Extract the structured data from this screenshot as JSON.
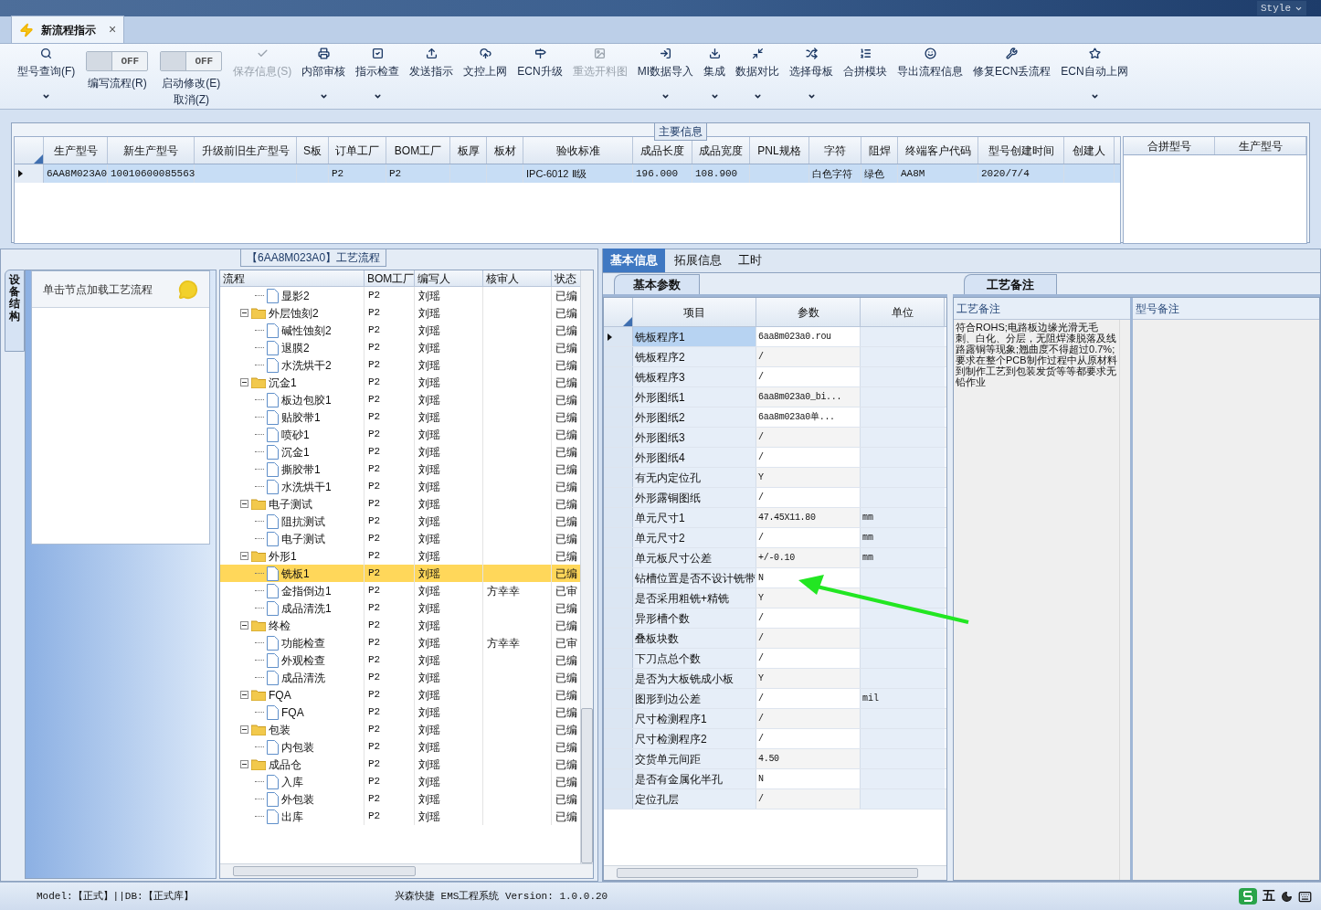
{
  "window": {
    "style_menu": "Style"
  },
  "doc_tab": {
    "title": "新流程指示",
    "close": "×"
  },
  "toolbar": [
    {
      "kind": "button",
      "label": "型号查询(F)",
      "dropdown": true,
      "disabled": false
    },
    {
      "kind": "toggle",
      "label": "编写流程(R)",
      "switch_text": "OFF",
      "on": false
    },
    {
      "kind": "toggle",
      "label": "启动修改(E)",
      "sub_label": "取消(Z)",
      "switch_text": "OFF",
      "on": false
    },
    {
      "kind": "button",
      "label": "保存信息(S)",
      "dropdown": false,
      "disabled": true
    },
    {
      "kind": "button",
      "label": "内部审核",
      "dropdown": true,
      "disabled": false
    },
    {
      "kind": "button",
      "label": "指示检查",
      "dropdown": true,
      "disabled": false
    },
    {
      "kind": "button",
      "label": "发送指示",
      "dropdown": false,
      "disabled": false
    },
    {
      "kind": "button",
      "label": "文控上网",
      "dropdown": false,
      "disabled": false
    },
    {
      "kind": "button",
      "label": "ECN升级",
      "dropdown": false,
      "disabled": false
    },
    {
      "kind": "button",
      "label": "重选开料图",
      "dropdown": false,
      "disabled": true
    },
    {
      "kind": "button",
      "label": "MI数据导入",
      "dropdown": true,
      "disabled": false
    },
    {
      "kind": "button",
      "label": "集成",
      "dropdown": true,
      "disabled": false
    },
    {
      "kind": "button",
      "label": "数据对比",
      "dropdown": true,
      "disabled": false
    },
    {
      "kind": "button",
      "label": "选择母板",
      "dropdown": true,
      "disabled": false
    },
    {
      "kind": "button",
      "label": "合拼模块",
      "dropdown": false,
      "disabled": false
    },
    {
      "kind": "button",
      "label": "导出流程信息",
      "dropdown": false,
      "disabled": false
    },
    {
      "kind": "button",
      "label": "修复ECN丢流程",
      "dropdown": false,
      "disabled": false
    },
    {
      "kind": "button",
      "label": "ECN自动上网",
      "dropdown": true,
      "disabled": false
    }
  ],
  "main_info": {
    "title": "主要信息",
    "columns": [
      "生产型号",
      "新生产型号",
      "升级前旧生产型号",
      "S板",
      "订单工厂",
      "BOM工厂",
      "板厚",
      "板材",
      "验收标准",
      "成品长度",
      "成品宽度",
      "PNL规格",
      "字符",
      "阻焊",
      "终端客户代码",
      "型号创建时间",
      "创建人"
    ],
    "rows": [
      {
        "selected": true,
        "cells": [
          "6AA8M023A0",
          "10010600085563",
          null,
          null,
          "P2",
          "P2",
          null,
          null,
          "IPC-6012 Ⅱ级",
          "196.000",
          "108.900",
          null,
          "白色字符",
          "绿色",
          "AA8M",
          "2020/7/4",
          null
        ]
      }
    ],
    "side_columns": [
      "合拼型号",
      "生产型号"
    ]
  },
  "process_panel": {
    "title": "【6AA8M023A0】工艺流程",
    "side_tab": "设备结构",
    "hint": "单击节点加载工艺流程",
    "columns": [
      "流程",
      "BOM工厂",
      "编写人",
      "核审人",
      "状态"
    ],
    "tree": [
      {
        "kind": "leaf",
        "label": "显影2",
        "bom": "P2",
        "writer": "刘瑶",
        "status": "已编",
        "selected": false
      },
      {
        "kind": "folder",
        "label": "外层蚀刻2",
        "bom": "P2",
        "writer": "刘瑶",
        "status": "已编",
        "selected": false,
        "expanded": true,
        "children": [
          {
            "kind": "leaf",
            "label": "碱性蚀刻2",
            "bom": "P2",
            "writer": "刘瑶",
            "status": "已编",
            "selected": false
          },
          {
            "kind": "leaf",
            "label": "退膜2",
            "bom": "P2",
            "writer": "刘瑶",
            "status": "已编",
            "selected": false
          },
          {
            "kind": "leaf",
            "label": "水洗烘干2",
            "bom": "P2",
            "writer": "刘瑶",
            "status": "已编",
            "selected": false
          }
        ]
      },
      {
        "kind": "folder",
        "label": "沉金1",
        "bom": "P2",
        "writer": "刘瑶",
        "status": "已编",
        "selected": false,
        "expanded": true,
        "children": [
          {
            "kind": "leaf",
            "label": "板边包胶1",
            "bom": "P2",
            "writer": "刘瑶",
            "status": "已编",
            "selected": false
          },
          {
            "kind": "leaf",
            "label": "贴胶带1",
            "bom": "P2",
            "writer": "刘瑶",
            "status": "已编",
            "selected": false
          },
          {
            "kind": "leaf",
            "label": "喷砂1",
            "bom": "P2",
            "writer": "刘瑶",
            "status": "已编",
            "selected": false
          },
          {
            "kind": "leaf",
            "label": "沉金1",
            "bom": "P2",
            "writer": "刘瑶",
            "status": "已编",
            "selected": false
          },
          {
            "kind": "leaf",
            "label": "撕胶带1",
            "bom": "P2",
            "writer": "刘瑶",
            "status": "已编",
            "selected": false
          },
          {
            "kind": "leaf",
            "label": "水洗烘干1",
            "bom": "P2",
            "writer": "刘瑶",
            "status": "已编",
            "selected": false
          }
        ]
      },
      {
        "kind": "folder",
        "label": "电子测试",
        "bom": "P2",
        "writer": "刘瑶",
        "status": "已编",
        "selected": false,
        "expanded": true,
        "children": [
          {
            "kind": "leaf",
            "label": "阻抗测试",
            "bom": "P2",
            "writer": "刘瑶",
            "status": "已编",
            "selected": false
          },
          {
            "kind": "leaf",
            "label": "电子测试",
            "bom": "P2",
            "writer": "刘瑶",
            "status": "已编",
            "selected": false
          }
        ]
      },
      {
        "kind": "folder",
        "label": "外形1",
        "bom": "P2",
        "writer": "刘瑶",
        "status": "已编",
        "selected": false,
        "expanded": true,
        "children": [
          {
            "kind": "leaf",
            "label": "铣板1",
            "bom": "P2",
            "writer": "刘瑶",
            "status": "已编",
            "selected": true
          },
          {
            "kind": "leaf",
            "label": "金指倒边1",
            "bom": "P2",
            "writer": "刘瑶",
            "reviewer": "方幸幸",
            "status": "已审",
            "selected": false
          },
          {
            "kind": "leaf",
            "label": "成品清洗1",
            "bom": "P2",
            "writer": "刘瑶",
            "status": "已编",
            "selected": false
          }
        ]
      },
      {
        "kind": "folder",
        "label": "终检",
        "bom": "P2",
        "writer": "刘瑶",
        "status": "已编",
        "selected": false,
        "expanded": true,
        "children": [
          {
            "kind": "leaf",
            "label": "功能检查",
            "bom": "P2",
            "writer": "刘瑶",
            "reviewer": "方幸幸",
            "status": "已审",
            "selected": false
          },
          {
            "kind": "leaf",
            "label": "外观检查",
            "bom": "P2",
            "writer": "刘瑶",
            "status": "已编",
            "selected": false
          },
          {
            "kind": "leaf",
            "label": "成品清洗",
            "bom": "P2",
            "writer": "刘瑶",
            "status": "已编",
            "selected": false
          }
        ]
      },
      {
        "kind": "folder",
        "label": "FQA",
        "bom": "P2",
        "writer": "刘瑶",
        "status": "已编",
        "selected": false,
        "expanded": true,
        "children": [
          {
            "kind": "leaf",
            "label": "FQA",
            "bom": "P2",
            "writer": "刘瑶",
            "status": "已编",
            "selected": false
          }
        ]
      },
      {
        "kind": "folder",
        "label": "包装",
        "bom": "P2",
        "writer": "刘瑶",
        "status": "已编",
        "selected": false,
        "expanded": true,
        "children": [
          {
            "kind": "leaf",
            "label": "内包装",
            "bom": "P2",
            "writer": "刘瑶",
            "status": "已编",
            "selected": false
          }
        ]
      },
      {
        "kind": "folder",
        "label": "成品仓",
        "bom": "P2",
        "writer": "刘瑶",
        "status": "已编",
        "selected": false,
        "expanded": true,
        "children": [
          {
            "kind": "leaf",
            "label": "入库",
            "bom": "P2",
            "writer": "刘瑶",
            "status": "已编",
            "selected": false
          },
          {
            "kind": "leaf",
            "label": "外包装",
            "bom": "P2",
            "writer": "刘瑶",
            "status": "已编",
            "selected": false
          },
          {
            "kind": "leaf",
            "label": "出库",
            "bom": "P2",
            "writer": "刘瑶",
            "status": "已编",
            "selected": false
          }
        ]
      }
    ]
  },
  "detail_tabs": [
    {
      "label": "基本信息",
      "selected": true
    },
    {
      "label": "拓展信息",
      "selected": false
    },
    {
      "label": "工时",
      "selected": false
    }
  ],
  "params": {
    "tab": "基本参数",
    "columns": [
      "项目",
      "参数",
      "单位"
    ],
    "rows": [
      {
        "item": "铣板程序1",
        "value": "6aa8m023a0.rou",
        "selected": true
      },
      {
        "item": "铣板程序2",
        "value": "/",
        "selected": false
      },
      {
        "item": "铣板程序3",
        "value": "/",
        "selected": false
      },
      {
        "item": "外形图纸1",
        "value": "6aa8m023a0_bi...",
        "selected": false
      },
      {
        "item": "外形图纸2",
        "value": "6aa8m023a0单...",
        "selected": false
      },
      {
        "item": "外形图纸3",
        "value": "/",
        "selected": false
      },
      {
        "item": "外形图纸4",
        "value": "/",
        "selected": false
      },
      {
        "item": "有无内定位孔",
        "value": "Y",
        "selected": false
      },
      {
        "item": "外形露铜图纸",
        "value": "/",
        "selected": false
      },
      {
        "item": "单元尺寸1",
        "value": "47.45X11.80",
        "unit": "mm",
        "selected": false
      },
      {
        "item": "单元尺寸2",
        "value": "/",
        "unit": "mm",
        "selected": false
      },
      {
        "item": "单元板尺寸公差",
        "value": "+/-0.10",
        "unit": "mm",
        "selected": false
      },
      {
        "item": "钻槽位置是否不设计铣带",
        "value": "N",
        "selected": false
      },
      {
        "item": "是否采用粗铣+精铣",
        "value": "Y",
        "selected": false
      },
      {
        "item": "异形槽个数",
        "value": "/",
        "selected": false
      },
      {
        "item": "叠板块数",
        "value": "/",
        "selected": false
      },
      {
        "item": "下刀点总个数",
        "value": "/",
        "selected": false
      },
      {
        "item": "是否为大板铣成小板",
        "value": "Y",
        "selected": false
      },
      {
        "item": "图形到边公差",
        "value": "/",
        "unit": "mil",
        "selected": false
      },
      {
        "item": "尺寸检测程序1",
        "value": "/",
        "selected": false
      },
      {
        "item": "尺寸检测程序2",
        "value": "/",
        "selected": false
      },
      {
        "item": "交货单元间距",
        "value": "4.50",
        "selected": false
      },
      {
        "item": "是否有金属化半孔",
        "value": "N",
        "selected": false
      },
      {
        "item": "定位孔层",
        "value": "/",
        "selected": false
      }
    ]
  },
  "remarks": {
    "tab": "工艺备注",
    "columns": [
      "工艺备注",
      "型号备注"
    ],
    "process_note": "符合ROHS;电路板边缘光滑无毛刺、白化、分层，无阻焊漆脱落及线路露铜等现象;翘曲度不得超过0.7%;要求在整个PCB制作过程中从原材料到制作工艺到包装发货等等都要求无铅作业"
  },
  "status_bar": {
    "left": "Model:【正式】||DB:【正式库】",
    "center": "兴森快捷 EMS工程系统 Version: 1.0.0.20",
    "ime": "五"
  }
}
